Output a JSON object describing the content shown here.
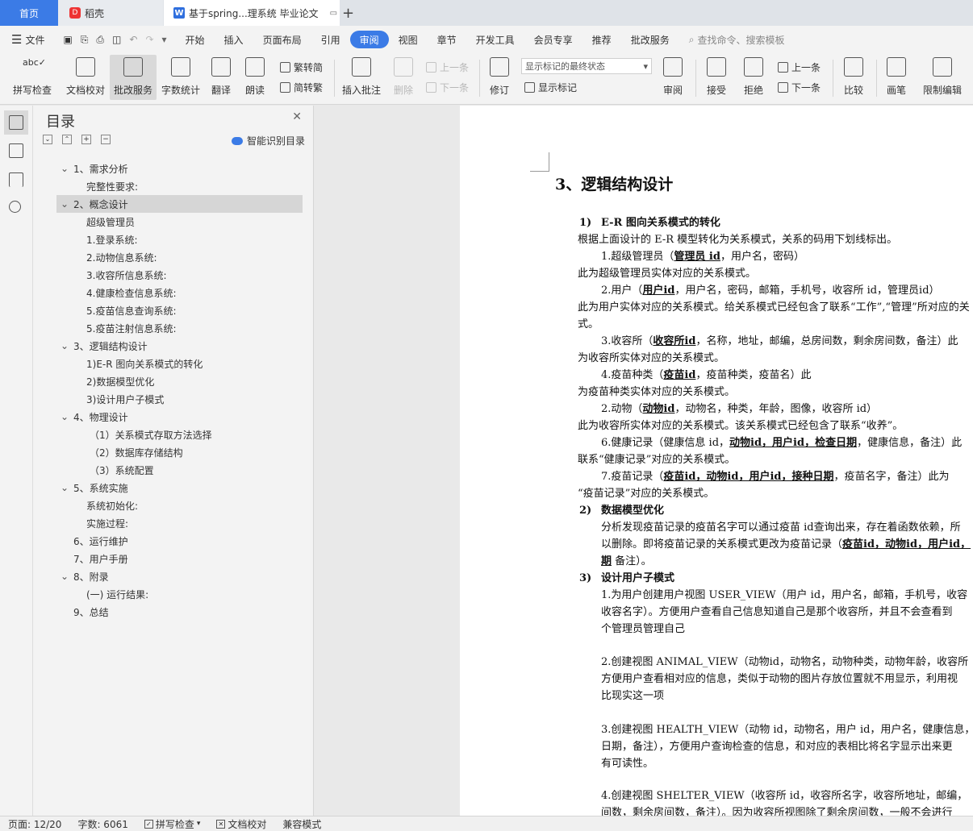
{
  "tabs": {
    "home": "首页",
    "daoke": "稻壳",
    "doc": "基于spring...理系统 毕业论文",
    "add": "+"
  },
  "menu": {
    "file": "文件",
    "items": [
      "开始",
      "插入",
      "页面布局",
      "引用",
      "审阅",
      "视图",
      "章节",
      "开发工具",
      "会员专享",
      "推荐",
      "批改服务"
    ],
    "active_index": 4,
    "search_placeholder": "查找命令、搜索模板"
  },
  "ribbon": {
    "spell": "拼写检查",
    "doccheck": "文档校对",
    "correct": "批改服务",
    "wordcount": "字数统计",
    "translate": "翻译",
    "read": "朗读",
    "trad": "繁转简",
    "simp": "简转繁",
    "insert_comment": "插入批注",
    "delete": "删除",
    "prev": "上一条",
    "next": "下一条",
    "track": "修订",
    "markup_select": "显示标记的最终状态",
    "show_markup": "显示标记",
    "review": "审阅",
    "accept": "接受",
    "reject": "拒绝",
    "prev2": "上一条",
    "next2": "下一条",
    "compare": "比较",
    "pen": "画笔",
    "restrict": "限制编辑"
  },
  "toc": {
    "title": "目录",
    "smart": "智能识别目录",
    "items": [
      {
        "label": "1、需求分析",
        "expand": true
      },
      {
        "label": "完整性要求:"
      },
      {
        "label": "2、概念设计",
        "expand": true
      },
      {
        "label": "超级管理员"
      },
      {
        "label": "1.登录系统:"
      },
      {
        "label": "2.动物信息系统:"
      },
      {
        "label": "3.收容所信息系统:"
      },
      {
        "label": "4.健康检查信息系统:"
      },
      {
        "label": "5.疫苗信息查询系统:"
      },
      {
        "label": "5.疫苗注射信息系统:"
      },
      {
        "label": "3、逻辑结构设计",
        "expand": true
      },
      {
        "label": "1)E-R 图向关系模式的转化"
      },
      {
        "label": "2)数据模型优化"
      },
      {
        "label": "3)设计用户子模式"
      },
      {
        "label": "4、物理设计",
        "expand": true
      },
      {
        "label": "（1）关系模式存取方法选择"
      },
      {
        "label": "（2）数据库存储结构"
      },
      {
        "label": "（3）系统配置"
      },
      {
        "label": "5、系统实施",
        "expand": true
      },
      {
        "label": "系统初始化:"
      },
      {
        "label": "实施过程:"
      },
      {
        "label": "6、运行维护"
      },
      {
        "label": "7、用户手册"
      },
      {
        "label": "8、附录",
        "expand": true
      },
      {
        "label": "(一) 运行结果:"
      },
      {
        "label": "9、总结"
      }
    ],
    "selected_index": 2
  },
  "doc": {
    "heading": "3、逻辑结构设计",
    "s1_num": "1)",
    "s1_title": "E-R 图向关系模式的转化",
    "p1": "根据上面设计的 E-R 模型转化为关系模式，关系的码用下划线标出。",
    "r1_a": "1.超级管理员（",
    "r1_key": "管理员 id",
    "r1_b": "，用户名，密码）",
    "r1_note": "此为超级管理员实体对应的关系模式。",
    "r2_a": "2.用户（",
    "r2_key": "用户id",
    "r2_b": "，用户名，密码，邮箱，手机号，收容所 id，管理员id）",
    "r2_note": "此为用户实体对应的关系模式。给关系模式已经包含了联系“工作”,“管理”所对应的关",
    "r2_note2": "式。",
    "r3_a": "3.收容所（",
    "r3_key": "收容所id",
    "r3_b": "，名称，地址，邮编，总房间数，剩余房间数，备注）此",
    "r3_note": "为收容所实体对应的关系模式。",
    "r4_a": "4.疫苗种类（",
    "r4_key": "疫苗id",
    "r4_b": "，疫苗种类，疫苗名）此",
    "r4_note": "为疫苗种类实体对应的关系模式。",
    "r5_a": "2.动物（",
    "r5_key": "动物id",
    "r5_b": "，动物名，种类，年龄，图像，收容所 id）",
    "r5_note": "此为收容所实体对应的关系模式。该关系模式已经包含了联系“收养”。",
    "r6_a": "6.健康记录（健康信息 id，",
    "r6_key": "动物id，用户id，检查日期",
    "r6_b": "，健康信息，备注）此",
    "r6_note": "联系“健康记录”对应的关系模式。",
    "r7_a": "7.疫苗记录（",
    "r7_key": "疫苗id，动物id，用户id，接种日期",
    "r7_b": "，疫苗名字，备注）此为",
    "r7_note": "“疫苗记录”对应的关系模式。",
    "s2_num": "2)",
    "s2_title": "数据模型优化",
    "s2_p1": "分析发现疫苗记录的疫苗名字可以通过疫苗 id查询出来，存在着函数依赖，所",
    "s2_p2a": "以删除。即将疫苗记录的关系模式更改为疫苗记录（",
    "s2_key": "疫苗id，动物id，用户id，",
    "s2_p3key": "期",
    "s2_p3b": " 备注）。",
    "s3_num": "3)",
    "s3_title": "设计用户子模式",
    "v1a": "1.为用户创建用户视图 USER_VIEW（用户 id，用户名，邮箱，手机号，收容",
    "v1b": "收容名字）。方便用户查看自己信息知道自己是那个收容所，并且不会查看到",
    "v1c": "个管理员管理自己",
    "v2a": "2.创建视图 ANIMAL_VIEW（动物id，动物名，动物种类，动物年龄，收容所",
    "v2b": "方便用户查看相对应的信息，类似于动物的图片存放位置就不用显示，利用视",
    "v2c": "比现实这一项",
    "v3a": "3.创建视图 HEALTH_VIEW（动物 id，动物名，用户 id，用户名，健康信息，",
    "v3b": "日期，备注），方便用户查询检查的信息，和对应的表相比将名字显示出来更",
    "v3c": "有可读性。",
    "v4a": "4.创建视图 SHELTER_VIEW（收容所 id，收容所名字，收容所地址，邮编，",
    "v4b": "间数，剩余房间数，备注）。因为收容所视图除了剩余房间数，一般不会进行"
  },
  "status": {
    "page": "页面: 12/20",
    "words": "字数: 6061",
    "spell": "拼写检查",
    "check": "文档校对",
    "compat": "兼容模式"
  },
  "colors": {
    "accent": "#3b7be6"
  }
}
